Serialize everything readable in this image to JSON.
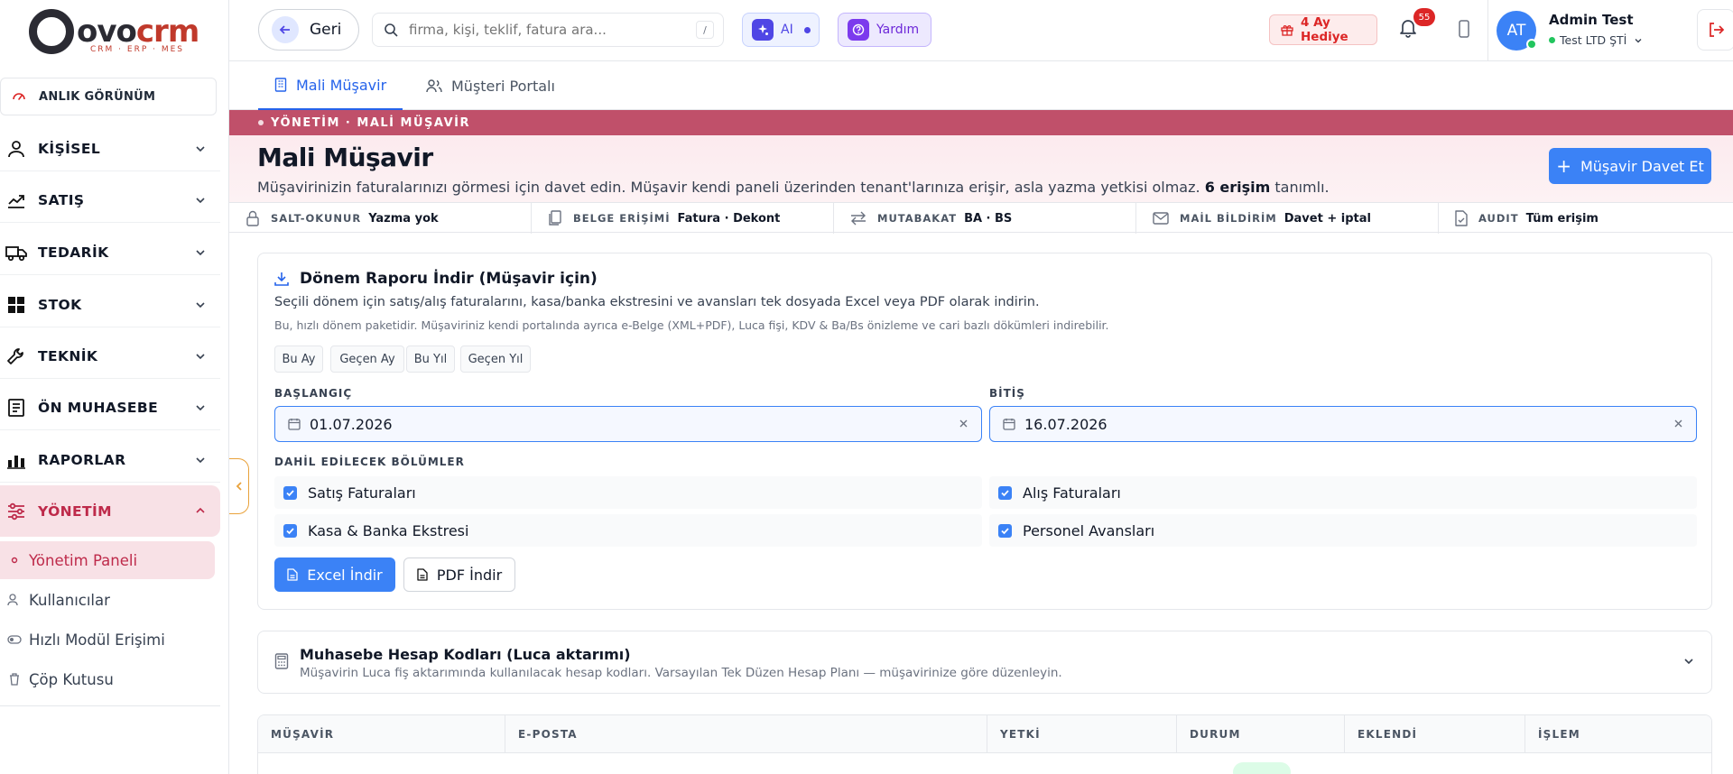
{
  "brand": {
    "name_part1": "ovo",
    "name_part2": "crm",
    "tagline": "CRM · ERP · MES"
  },
  "sidebar": {
    "snapshot_label": "ANLIK GÖRÜNÜM",
    "items": [
      {
        "label": "KİŞİSEL"
      },
      {
        "label": "SATIŞ"
      },
      {
        "label": "TEDARİK"
      },
      {
        "label": "STOK"
      },
      {
        "label": "TEKNİK"
      },
      {
        "label": "ÖN MUHASEBE"
      },
      {
        "label": "RAPORLAR"
      },
      {
        "label": "YÖNETİM"
      }
    ],
    "subitems": [
      {
        "label": "Yönetim Paneli"
      },
      {
        "label": "Kullanıcılar"
      },
      {
        "label": "Hızlı Modül Erişimi"
      },
      {
        "label": "Çöp Kutusu"
      }
    ]
  },
  "topbar": {
    "back_label": "Geri",
    "search_placeholder": "firma, kişi, teklif, fatura ara...",
    "search_shortcut": "/",
    "ai_label": "AI",
    "help_label": "Yardım",
    "gift_label": "4 Ay Hediye",
    "notification_count": "55",
    "user_initials": "AT",
    "user_name": "Admin Test",
    "company": "Test LTD ŞTİ"
  },
  "tabs": [
    {
      "label": "Mali Müşavir"
    },
    {
      "label": "Müşteri Portalı"
    }
  ],
  "banner": {
    "breadcrumb": "YÖNETİM · MALİ MÜŞAVİR",
    "title": "Mali Müşavir",
    "description": "Müşavirinizin faturalarınızı görmesi için davet edin. Müşavir kendi paneli üzerinden tenant'larınıza erişir, asla yazma yetkisi olmaz.",
    "access_count": "6 erişim",
    "access_suffix": "tanımlı.",
    "invite_label": "Müşavir Davet Et"
  },
  "info_strip": [
    {
      "key": "SALT-OKUNUR",
      "value": "Yazma yok"
    },
    {
      "key": "BELGE ERİŞİMİ",
      "value": "Fatura · Dekont"
    },
    {
      "key": "MUTABAKAT",
      "value": "BA · BS"
    },
    {
      "key": "MAİL BİLDİRİM",
      "value": "Davet + iptal"
    },
    {
      "key": "AUDIT",
      "value": "Tüm erişim"
    }
  ],
  "report": {
    "title": "Dönem Raporu İndir (Müşavir için)",
    "description": "Seçili dönem için satış/alış faturalarını, kasa/banka ekstresini ve avansları tek dosyada Excel veya PDF olarak indirin.",
    "note": "Bu, hızlı dönem paketidir. Müşaviriniz kendi portalında ayrıca e-Belge (XML+PDF), Luca fişi, KDV & Ba/Bs önizleme ve cari bazlı dökümleri indirebilir.",
    "quick_ranges": [
      "Bu Ay",
      "Geçen Ay",
      "Bu Yıl",
      "Geçen Yıl"
    ],
    "start_label": "BAŞLANGIÇ",
    "start_value": "01.07.2026",
    "end_label": "BİTİŞ",
    "end_value": "16.07.2026",
    "sections_label": "DAHİL EDİLECEK BÖLÜMLER",
    "sections": [
      {
        "label": "Satış Faturaları",
        "checked": true
      },
      {
        "label": "Alış Faturaları",
        "checked": true
      },
      {
        "label": "Kasa & Banka Ekstresi",
        "checked": true
      },
      {
        "label": "Personel Avansları",
        "checked": true
      }
    ],
    "excel_label": "Excel İndir",
    "pdf_label": "PDF İndir"
  },
  "accounts": {
    "title": "Muhasebe Hesap Kodları (Luca aktarımı)",
    "description": "Müşavirin Luca fiş aktarımında kullanılacak hesap kodları. Varsayılan Tek Düzen Hesap Planı — müşavirinize göre düzenleyin."
  },
  "table": {
    "headers": [
      "MÜŞAVİR",
      "E-POSTA",
      "YETKİ",
      "DURUM",
      "EKLENDİ",
      "İŞLEM"
    ]
  }
}
